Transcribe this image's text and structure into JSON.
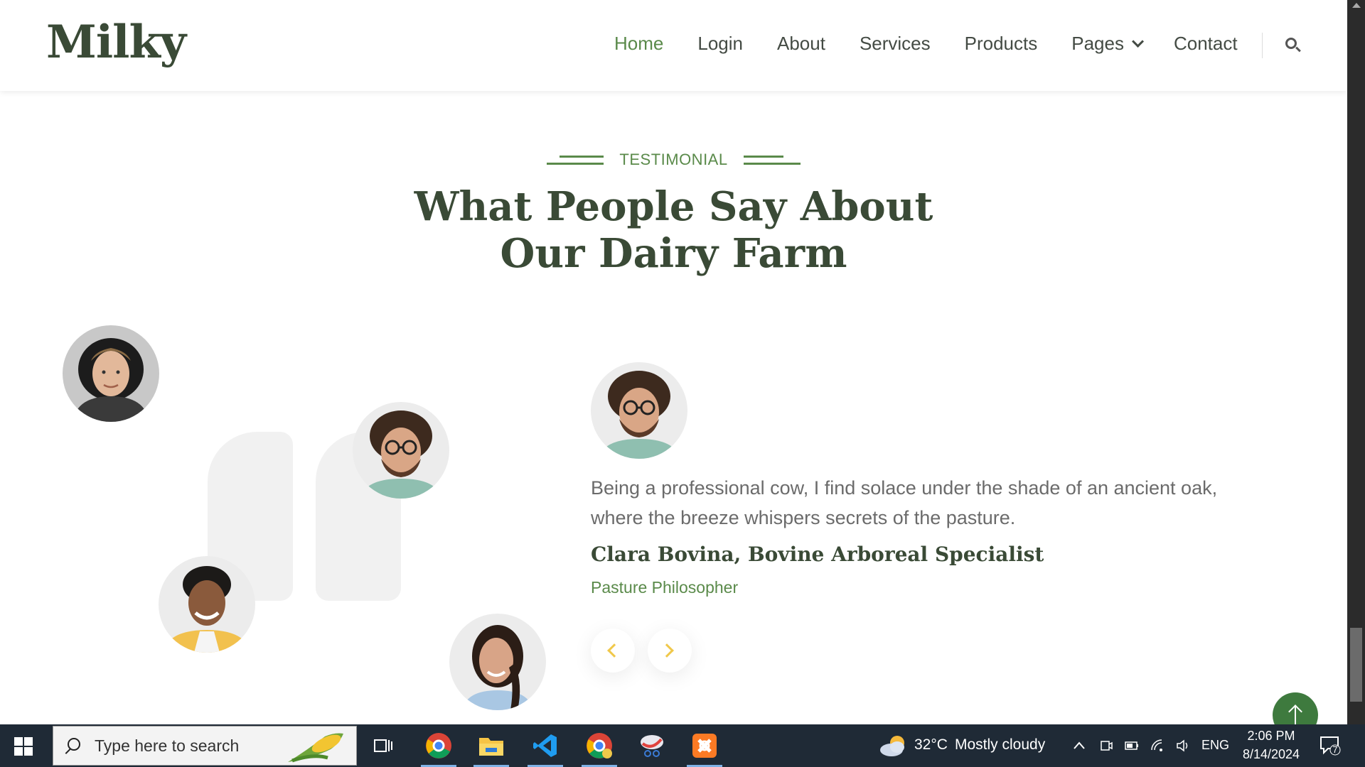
{
  "site": {
    "logo": "Milky",
    "nav": [
      {
        "label": "Home",
        "active": true
      },
      {
        "label": "Login"
      },
      {
        "label": "About"
      },
      {
        "label": "Services"
      },
      {
        "label": "Products"
      },
      {
        "label": "Pages",
        "has_dropdown": true
      },
      {
        "label": "Contact"
      }
    ],
    "search_icon": "search-icon"
  },
  "section": {
    "subtitle": "TESTIMONIAL",
    "heading_line1": "What People Say About",
    "heading_line2": "Our Dairy Farm"
  },
  "testimonial": {
    "quote": "Being a professional cow, I find solace under the shade of an ancient oak, where the breeze whispers secrets of the pasture.",
    "name": "Clara Bovina, Bovine Arboreal Specialist",
    "role": "Pasture Philosopher",
    "prev_icon": "chevron-left-icon",
    "next_icon": "chevron-right-icon"
  },
  "colors": {
    "brand_dark": "#3a4a36",
    "accent_green": "#5a8a4a",
    "arrow_yellow": "#f0c84a",
    "back_to_top": "#3e7a3e"
  },
  "taskbar": {
    "search_placeholder": "Type here to search",
    "weather_temp": "32°C",
    "weather_desc": "Mostly cloudy",
    "language": "ENG",
    "time": "2:06 PM",
    "date": "8/14/2024",
    "notification_count": "7",
    "apps": [
      "task-view-icon",
      "chrome-profile-icon",
      "file-explorer-icon",
      "vscode-icon",
      "chrome-canary-icon",
      "snipping-tool-icon",
      "xampp-icon"
    ]
  }
}
